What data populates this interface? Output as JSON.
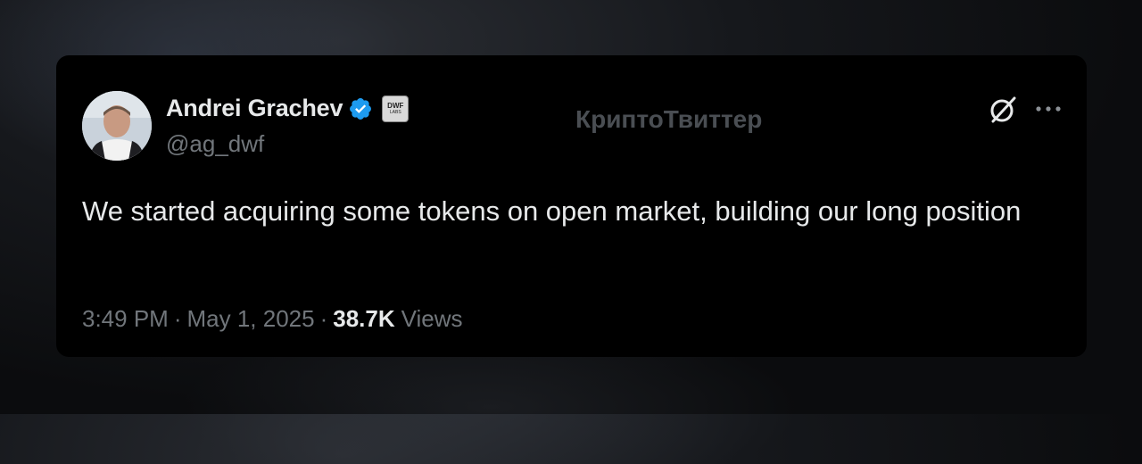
{
  "tweet": {
    "author_name": "Andrei Grachev",
    "author_handle": "@ag_dwf",
    "verified_color": "#1d9bf0",
    "affiliate_badge_line1": "DWF",
    "affiliate_badge_line2": "LABS",
    "text": "We started acquiring some tokens on open market, building our long position",
    "time": "3:49 PM",
    "date": "May 1, 2025",
    "separator": "·",
    "views_count": "38.7K",
    "views_label": "Views"
  },
  "watermark": "КриптоТвиттер",
  "icons": {
    "verified": "verified-badge-icon",
    "grok": "grok-icon",
    "more": "more-options-icon"
  }
}
